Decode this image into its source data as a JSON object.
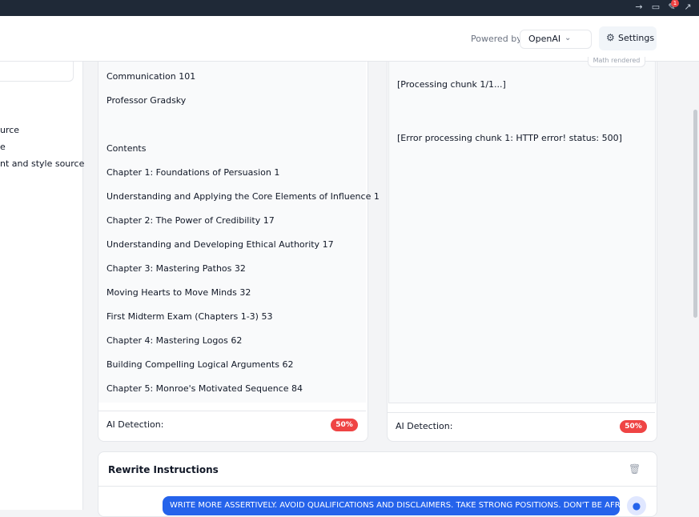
{
  "topbar": {
    "icons": [
      "arrow-icon",
      "monitor-icon",
      "tools-icon",
      "external-link-icon"
    ],
    "badge_count": "1"
  },
  "header": {
    "powered_by_label": "Powered by",
    "provider": "OpenAI",
    "settings_label": "Settings"
  },
  "sidebar": {
    "options": [
      "urce",
      "e",
      "nt and style source"
    ]
  },
  "input_doc": {
    "lines": [
      "Communication 101",
      "Professor Gradsky",
      "Contents",
      "Chapter 1: Foundations of Persuasion    1",
      "Understanding and Applying the Core Elements of Influence   1",
      "Chapter 2: The Power of Credibility    17",
      "Understanding and Developing Ethical Authority  17",
      "Chapter 3: Mastering Pathos   32",
      "Moving Hearts to Move Minds   32",
      "First Midterm Exam (Chapters 1-3) 53",
      "Chapter 4: Mastering Logos    62",
      "Building Compelling Logical Arguments    62",
      "Chapter 5: Monroe's Motivated Sequence 84"
    ],
    "ai_detection_label": "AI Detection:",
    "ai_detection_value": "50%"
  },
  "output_doc": {
    "tag": "Math rendered",
    "lines": [
      "[Processing chunk 1/1...]",
      "[Error processing chunk 1: HTTP error! status: 500]"
    ],
    "ai_detection_label": "AI Detection:",
    "ai_detection_value": "50%"
  },
  "rewrite": {
    "title": "Rewrite Instructions",
    "message": "WRITE MORE ASSERTIVELY. AVOID QUALIFICATIONS AND DISCLAIMERS. TAKE STRONG POSITIONS. DON'T BE AFRAID"
  },
  "colors": {
    "accent": "#2563eb",
    "danger": "#ef4444"
  }
}
